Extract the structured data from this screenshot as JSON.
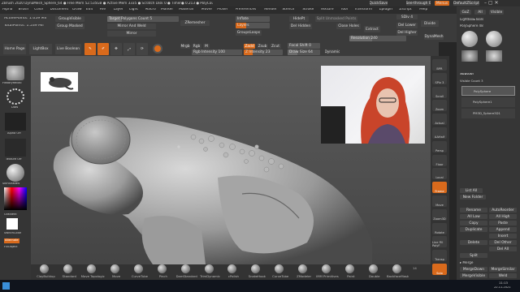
{
  "title_bar": {
    "text": "ZBrush 2020  DynaMesh_Sphere_64  ● Free Mem 52.535GB ● Active Mem 3335 ● Scratch Disk 0 ● Timer● 0.213 ● PolyCount● 1.059 MP ● MeshCount● 2",
    "quicksave": "QuickSave",
    "seethrough": "See-through 0",
    "menus_label": "Menus",
    "default_script": "DefaultZScript"
  },
  "menu_items": [
    "Alpha",
    "Brush",
    "Color",
    "Document",
    "Draw",
    "Edit",
    "File",
    "Layer",
    "Light",
    "Macro",
    "Marker",
    "Material",
    "Movie",
    "Picker",
    "Preferences",
    "Render",
    "Stencil",
    "Stroke",
    "Texture",
    "Tool",
    "Transform",
    "Zplugin",
    "Zscript",
    "Help"
  ],
  "top_shelf": {
    "active_points": "ActivePoints: 1.059 Mil",
    "total_points": "TotalPoints: 1.539 Mil",
    "group_visible": "GroupVisible",
    "group_masked": "Group Masked",
    "target_polygons": "Target Polygons Count 5",
    "mirror_and_weld": "Mirror And Weld",
    "mirror": "Mirror",
    "zremesher": "ZRemesher",
    "inflate": "Inflate",
    "layers": "Layers",
    "group_loops": "GroupsLoops",
    "hide_pt": "HidePt",
    "del_hidden": "Del Hidden",
    "close_holes": "Close Holes",
    "extract": "Extract",
    "del_lower": "Del Lower",
    "del_higher": "Del Higher",
    "divide": "Divide",
    "sdiv": "SDiv 4",
    "split_unmasked": "Split Unmasked Points",
    "dynamesh": "DynaMesh",
    "resolution": "Resolution 240"
  },
  "tool_row": {
    "home_page": "Home Page",
    "lightbox": "LightBox",
    "live_boolean": "Live Boolean",
    "edit": "Edit",
    "draw": "Draw",
    "move": "Move",
    "scale": "Scale",
    "rotate": "Rotate",
    "mrgb": "Mrgb",
    "rgb": "Rgb",
    "m": "M",
    "zadd": "Zadd",
    "zsub": "Zsub",
    "zcut": "Zcut",
    "rgb_intensity": "Rgb Intensity 100",
    "z_intensity": "Z Intensity 23",
    "focal_shift": "Focal Shift 0",
    "draw_size": "Draw Size 64",
    "dynamic": "Dynamic",
    "coords": "1.11,135.1,464"
  },
  "left_shelf": {
    "brush_name": "HistoryRecall",
    "stroke": "Dots",
    "alpha": "Alpha Off",
    "texture": "Texture Off",
    "material": "SkinShade4",
    "gradient": "Gradient",
    "switch_color": "SwitchColor",
    "alternate": "Alternate",
    "fill_object": "FillObject"
  },
  "right_strip": [
    "BPR",
    "SPix 3",
    "Scroll",
    "Zoom",
    "Actual",
    "AAHalf",
    "Persp",
    "Floor",
    "Local",
    "Frame",
    "Move",
    "Zoom3D",
    "Rotate",
    "Line Fill PolyF",
    "Transp",
    "Solo"
  ],
  "right_panel": {
    "goz": "GoZ",
    "all": "All",
    "visible": "Visible",
    "lightbox_tools": "Lightbox▸Tools",
    "current_tool": "PolySphere 48",
    "tool_thumbs": [
      "PolySphere",
      "SphereBrush",
      "AlphaBrush",
      "PolyMesh3D",
      "SimpleBrush"
    ],
    "subtool": "Subtool",
    "visible_count": "Visible Count 3",
    "subtools": [
      "PolySphere",
      "PolySphere1",
      "PM3D_Sphere3D1"
    ],
    "list_all": "List All",
    "auto_collapse": "Auto Collapse",
    "new_folder": "New Folder",
    "actions": [
      [
        "Rename",
        "AutoReorder"
      ],
      [
        "All Low",
        "All High"
      ],
      [
        "Copy",
        "Paste"
      ],
      [
        "Duplicate",
        "Append"
      ],
      [
        "",
        "Insert"
      ],
      [
        "Delete",
        "Del Other"
      ],
      [
        "",
        "Del All"
      ],
      [
        "Split",
        ""
      ]
    ],
    "merge": "▸ Merge",
    "merge_down": "MergeDown",
    "merge_similar": "MergeSimilar",
    "merge_visible": "MergeVisible",
    "weld": "Weld"
  },
  "brushes": [
    "ClayBuildup",
    "Standard",
    "Move Topologica",
    "Move",
    "CurveTube",
    "Pinch",
    "DamStandard",
    "TrimDynamic",
    "cPolish",
    "SnakeHook",
    "CurveTube",
    "ZModeler",
    "IMM Primitives",
    "Paint",
    "Double",
    "BackfaceMask"
  ],
  "brush_count": "14",
  "taskbar": {
    "time": "11:13",
    "date": "22.11.2021"
  },
  "colors": {
    "accent": "#d96a1c",
    "bg": "#262626",
    "panel": "#3b3b3b"
  }
}
